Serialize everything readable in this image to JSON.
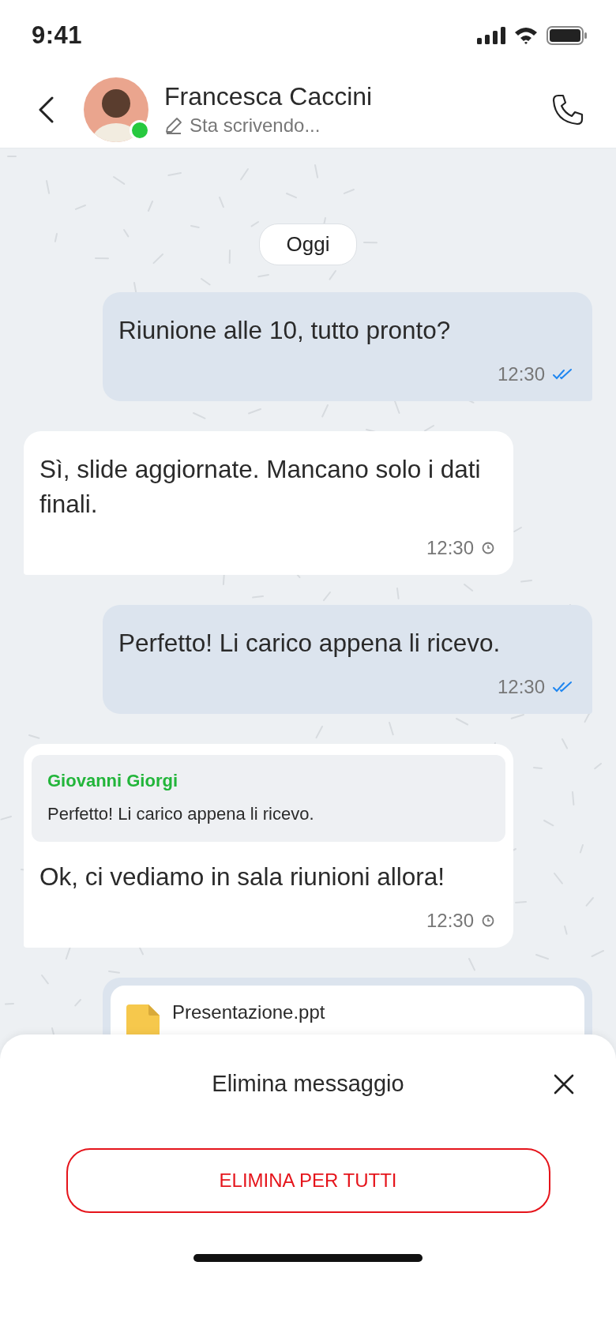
{
  "status_bar": {
    "time": "9:41"
  },
  "header": {
    "contact_name": "Francesca Caccini",
    "status": "Sta scrivendo...",
    "online": true
  },
  "date_chip": "Oggi",
  "messages": [
    {
      "kind": "text",
      "outgoing": true,
      "text": "Riunione alle 10, tutto pronto?",
      "time": "12:30",
      "read": true
    },
    {
      "kind": "text",
      "outgoing": false,
      "text": "Sì, slide aggiornate. Mancano solo i dati finali.",
      "time": "12:30",
      "read": false
    },
    {
      "kind": "text",
      "outgoing": true,
      "text": "Perfetto! Li carico appena li ricevo.",
      "time": "12:30",
      "read": true
    },
    {
      "kind": "reply",
      "outgoing": false,
      "quote_author": "Giovanni Giorgi",
      "quote_text": "Perfetto! Li carico appena li ricevo.",
      "text": "Ok, ci vediamo in sala riunioni allora!",
      "time": "12:30",
      "read": false
    },
    {
      "kind": "file",
      "outgoing": true,
      "file_name": "Presentazione.ppt"
    }
  ],
  "sheet": {
    "title": "Elimina messaggio",
    "buttons": [
      "ELIMINA PER TUTTI"
    ]
  }
}
